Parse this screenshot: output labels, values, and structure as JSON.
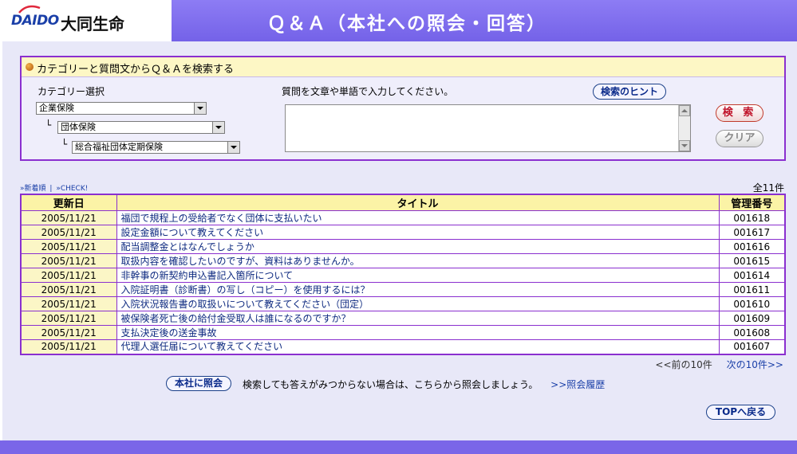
{
  "brand": {
    "logo_text": "DAIDO",
    "company_name": "大同生命"
  },
  "page_title": "Ｑ＆Ａ（本社への照会・回答）",
  "search": {
    "heading": "カテゴリーと質問文からＱ＆Ａを検索する",
    "category_label": "カテゴリー選択",
    "category_1": "企業保険",
    "category_2": "団体保険",
    "category_3": "総合福祉団体定期保険",
    "elbow_mark": "└",
    "question_label": "質問を文章や単語で入力してください。",
    "question_value": "",
    "hint_button": "検索のヒント",
    "search_button": "検 索",
    "clear_button": "クリア"
  },
  "list": {
    "sort_newest": "»新着順",
    "separator": "|",
    "sort_check": "»CHECK!",
    "total": "全11件",
    "headers": {
      "date": "更新日",
      "title": "タイトル",
      "number": "管理番号"
    },
    "rows": [
      {
        "date": "2005/11/21",
        "title": "福団で規程上の受給者でなく団体に支払いたい",
        "number": "001618"
      },
      {
        "date": "2005/11/21",
        "title": "設定金額について教えてください",
        "number": "001617"
      },
      {
        "date": "2005/11/21",
        "title": "配当調整金とはなんでしょうか",
        "number": "001616"
      },
      {
        "date": "2005/11/21",
        "title": "取扱内容を確認したいのですが、資料はありませんか。",
        "number": "001615"
      },
      {
        "date": "2005/11/21",
        "title": "非幹事の新契約申込書記入箇所について",
        "number": "001614"
      },
      {
        "date": "2005/11/21",
        "title": "入院証明書（診断書）の写し（コピー）を使用するには？",
        "number": "001611"
      },
      {
        "date": "2005/11/21",
        "title": "入院状況報告書の取扱いについて教えてください（団定）",
        "number": "001610"
      },
      {
        "date": "2005/11/21",
        "title": "被保険者死亡後の給付金受取人は誰になるのですか？",
        "number": "001609"
      },
      {
        "date": "2005/11/21",
        "title": "支払決定後の送金事故",
        "number": "001608"
      },
      {
        "date": "2005/11/21",
        "title": "代理人選任届について教えてください",
        "number": "001607"
      }
    ],
    "prev_page": "<<前の10件",
    "next_page": "次の10件>>"
  },
  "contact": {
    "button": "本社に照会",
    "note": "検索しても答えがみつからない場合は、こちらから照会しましょう。",
    "history_link": ">>照会履歴"
  },
  "top_button": "TOPへ戻る",
  "colors": {
    "accent_purple": "#8a2fcf",
    "header_purple": "#7462e8",
    "row_yellow": "#fbf6c6",
    "link_blue": "#1a3fa8"
  }
}
